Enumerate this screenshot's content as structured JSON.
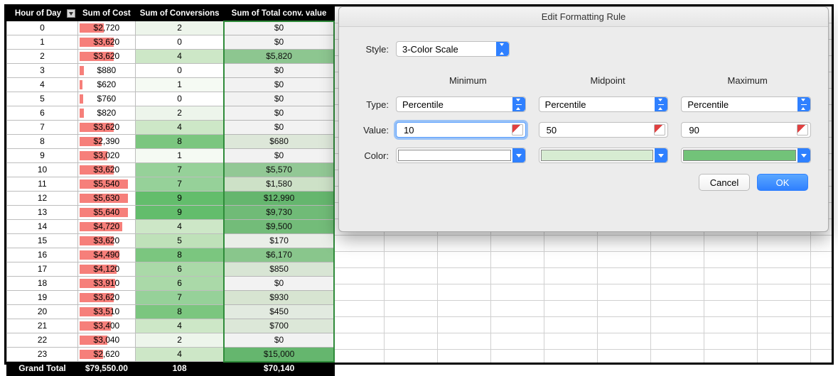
{
  "pivot": {
    "headers": [
      "Hour of Day",
      "Sum of Cost",
      "Sum of Conversions",
      "Sum of Total conv. value"
    ],
    "rows": [
      {
        "hour": "0",
        "cost": "$2,720",
        "cost_pct": 0.5,
        "conv": "2",
        "conv_shade": "#edf5eb",
        "totv": "$0",
        "totv_shade": "#ffffff"
      },
      {
        "hour": "1",
        "cost": "$3,620",
        "cost_pct": 0.7,
        "conv": "0",
        "conv_shade": "#ffffff",
        "totv": "$0",
        "totv_shade": "#ffffff"
      },
      {
        "hour": "2",
        "cost": "$3,620",
        "cost_pct": 0.7,
        "conv": "4",
        "conv_shade": "#cde7c7",
        "totv": "$5,820",
        "totv_shade": "#8fcf92"
      },
      {
        "hour": "3",
        "cost": "$880",
        "cost_pct": 0.09,
        "conv": "0",
        "conv_shade": "#ffffff",
        "totv": "$0",
        "totv_shade": "#ffffff"
      },
      {
        "hour": "4",
        "cost": "$620",
        "cost_pct": 0.06,
        "conv": "1",
        "conv_shade": "#f5faf3",
        "totv": "$0",
        "totv_shade": "#ffffff"
      },
      {
        "hour": "5",
        "cost": "$760",
        "cost_pct": 0.08,
        "conv": "0",
        "conv_shade": "#ffffff",
        "totv": "$0",
        "totv_shade": "#ffffff"
      },
      {
        "hour": "6",
        "cost": "$820",
        "cost_pct": 0.09,
        "conv": "2",
        "conv_shade": "#edf5eb",
        "totv": "$0",
        "totv_shade": "#ffffff"
      },
      {
        "hour": "7",
        "cost": "$3,620",
        "cost_pct": 0.7,
        "conv": "4",
        "conv_shade": "#cde7c7",
        "totv": "$0",
        "totv_shade": "#ffffff"
      },
      {
        "hour": "8",
        "cost": "$2,390",
        "cost_pct": 0.45,
        "conv": "8",
        "conv_shade": "#7bc67f",
        "totv": "$680",
        "totv_shade": "#e8f3e4"
      },
      {
        "hour": "9",
        "cost": "$3,020",
        "cost_pct": 0.58,
        "conv": "1",
        "conv_shade": "#f5faf3",
        "totv": "$0",
        "totv_shade": "#ffffff"
      },
      {
        "hour": "10",
        "cost": "$3,620",
        "cost_pct": 0.7,
        "conv": "7",
        "conv_shade": "#96d199",
        "totv": "$5,570",
        "totv_shade": "#95d198"
      },
      {
        "hour": "11",
        "cost": "$5,540",
        "cost_pct": 1.0,
        "conv": "7",
        "conv_shade": "#96d199",
        "totv": "$1,580",
        "totv_shade": "#d6ecd0"
      },
      {
        "hour": "12",
        "cost": "$5,630",
        "cost_pct": 1.0,
        "conv": "9",
        "conv_shade": "#63bd6c",
        "totv": "$12,990",
        "totv_shade": "#63bd6c"
      },
      {
        "hour": "13",
        "cost": "$5,640",
        "cost_pct": 1.0,
        "conv": "9",
        "conv_shade": "#63bd6c",
        "totv": "$9,730",
        "totv_shade": "#6fc277"
      },
      {
        "hour": "14",
        "cost": "$4,720",
        "cost_pct": 0.88,
        "conv": "4",
        "conv_shade": "#cde7c7",
        "totv": "$9,500",
        "totv_shade": "#72c379"
      },
      {
        "hour": "15",
        "cost": "$3,620",
        "cost_pct": 0.7,
        "conv": "5",
        "conv_shade": "#bfe1b9",
        "totv": "$170",
        "totv_shade": "#f6fbf4"
      },
      {
        "hour": "16",
        "cost": "$4,490",
        "cost_pct": 0.83,
        "conv": "8",
        "conv_shade": "#7bc67f",
        "totv": "$6,170",
        "totv_shade": "#8bce8e"
      },
      {
        "hour": "17",
        "cost": "$4,120",
        "cost_pct": 0.77,
        "conv": "6",
        "conv_shade": "#aad9a8",
        "totv": "$850",
        "totv_shade": "#e3f1de"
      },
      {
        "hour": "18",
        "cost": "$3,910",
        "cost_pct": 0.73,
        "conv": "6",
        "conv_shade": "#aad9a8",
        "totv": "$0",
        "totv_shade": "#ffffff"
      },
      {
        "hour": "19",
        "cost": "$3,620",
        "cost_pct": 0.7,
        "conv": "7",
        "conv_shade": "#96d199",
        "totv": "$930",
        "totv_shade": "#e1f0db"
      },
      {
        "hour": "20",
        "cost": "$3,510",
        "cost_pct": 0.67,
        "conv": "8",
        "conv_shade": "#7bc67f",
        "totv": "$450",
        "totv_shade": "#eef6eb"
      },
      {
        "hour": "21",
        "cost": "$3,400",
        "cost_pct": 0.65,
        "conv": "4",
        "conv_shade": "#cde7c7",
        "totv": "$700",
        "totv_shade": "#e7f3e2"
      },
      {
        "hour": "22",
        "cost": "$3,040",
        "cost_pct": 0.58,
        "conv": "2",
        "conv_shade": "#edf5eb",
        "totv": "$0",
        "totv_shade": "#ffffff"
      },
      {
        "hour": "23",
        "cost": "$2,620",
        "cost_pct": 0.49,
        "conv": "4",
        "conv_shade": "#cde7c7",
        "totv": "$15,000",
        "totv_shade": "#63bd6c"
      }
    ],
    "total": {
      "label": "Grand Total",
      "cost": "$79,550.00",
      "conv": "108",
      "totv": "$70,140"
    }
  },
  "dialog": {
    "title": "Edit Formatting Rule",
    "style_label": "Style:",
    "style_value": "3-Color Scale",
    "col_headers": [
      "Minimum",
      "Midpoint",
      "Maximum"
    ],
    "row_labels": {
      "type": "Type:",
      "value": "Value:",
      "color": "Color:"
    },
    "types": [
      "Percentile",
      "Percentile",
      "Percentile"
    ],
    "values": [
      "10",
      "50",
      "90"
    ],
    "colors": [
      "#ffffff",
      "#d7ecd2",
      "#72c379"
    ],
    "buttons": {
      "cancel": "Cancel",
      "ok": "OK"
    }
  }
}
